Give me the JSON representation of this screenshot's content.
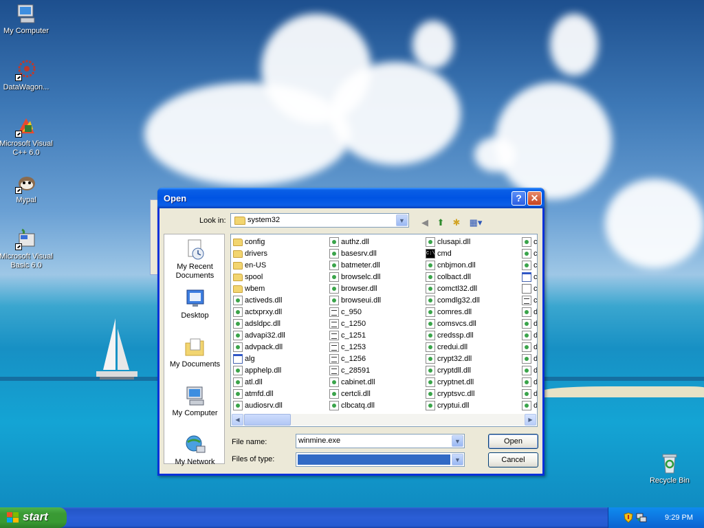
{
  "desktop": {
    "icons": [
      {
        "label": "My Computer"
      },
      {
        "label": "DataWagon..."
      },
      {
        "label": "Microsoft Visual C++ 6.0"
      },
      {
        "label": "Mypal"
      },
      {
        "label": "Microsoft Visual Basic 6.0"
      },
      {
        "label": "Recycle Bin"
      }
    ]
  },
  "dialog": {
    "title": "Open",
    "help_glyph": "?",
    "close_glyph": "✕",
    "look_in_label": "Look in:",
    "look_in_value": "system32",
    "places": [
      {
        "label": "My Recent Documents"
      },
      {
        "label": "Desktop"
      },
      {
        "label": "My Documents"
      },
      {
        "label": "My Computer"
      },
      {
        "label": "My Network"
      }
    ],
    "file_columns": [
      [
        {
          "name": "config",
          "type": "folder"
        },
        {
          "name": "drivers",
          "type": "folder"
        },
        {
          "name": "en-US",
          "type": "folder"
        },
        {
          "name": "spool",
          "type": "folder"
        },
        {
          "name": "wbem",
          "type": "folder"
        },
        {
          "name": "activeds.dll",
          "type": "dll"
        },
        {
          "name": "actxprxy.dll",
          "type": "dll"
        },
        {
          "name": "adsldpc.dll",
          "type": "dll"
        },
        {
          "name": "advapi32.dll",
          "type": "dll"
        },
        {
          "name": "advpack.dll",
          "type": "dll"
        },
        {
          "name": "alg",
          "type": "exe"
        },
        {
          "name": "apphelp.dll",
          "type": "dll"
        },
        {
          "name": "atl.dll",
          "type": "dll"
        },
        {
          "name": "atmfd.dll",
          "type": "dll"
        },
        {
          "name": "audiosrv.dll",
          "type": "dll"
        }
      ],
      [
        {
          "name": "authz.dll",
          "type": "dll"
        },
        {
          "name": "basesrv.dll",
          "type": "dll"
        },
        {
          "name": "batmeter.dll",
          "type": "dll"
        },
        {
          "name": "browselc.dll",
          "type": "dll"
        },
        {
          "name": "browser.dll",
          "type": "dll"
        },
        {
          "name": "browseui.dll",
          "type": "dll"
        },
        {
          "name": "c_950",
          "type": "nls"
        },
        {
          "name": "c_1250",
          "type": "nls"
        },
        {
          "name": "c_1251",
          "type": "nls"
        },
        {
          "name": "c_1253",
          "type": "nls"
        },
        {
          "name": "c_1256",
          "type": "nls"
        },
        {
          "name": "c_28591",
          "type": "nls"
        },
        {
          "name": "cabinet.dll",
          "type": "dll"
        },
        {
          "name": "certcli.dll",
          "type": "dll"
        },
        {
          "name": "clbcatq.dll",
          "type": "dll"
        }
      ],
      [
        {
          "name": "clusapi.dll",
          "type": "dll"
        },
        {
          "name": "cmd",
          "type": "cmd"
        },
        {
          "name": "cnbjmon.dll",
          "type": "dll"
        },
        {
          "name": "colbact.dll",
          "type": "dll"
        },
        {
          "name": "comctl32.dll",
          "type": "dll"
        },
        {
          "name": "comdlg32.dll",
          "type": "dll"
        },
        {
          "name": "comres.dll",
          "type": "dll"
        },
        {
          "name": "comsvcs.dll",
          "type": "dll"
        },
        {
          "name": "credssp.dll",
          "type": "dll"
        },
        {
          "name": "credui.dll",
          "type": "dll"
        },
        {
          "name": "crypt32.dll",
          "type": "dll"
        },
        {
          "name": "cryptdll.dll",
          "type": "dll"
        },
        {
          "name": "cryptnet.dll",
          "type": "dll"
        },
        {
          "name": "cryptsvc.dll",
          "type": "dll"
        },
        {
          "name": "cryptui.dll",
          "type": "dll"
        }
      ],
      [
        {
          "name": "cs",
          "type": "dll"
        },
        {
          "name": "cs",
          "type": "dll"
        },
        {
          "name": "cs",
          "type": "dll"
        },
        {
          "name": "cs",
          "type": "exe"
        },
        {
          "name": "ct",
          "type": "txt"
        },
        {
          "name": "ct",
          "type": "nls"
        },
        {
          "name": "da",
          "type": "dll"
        },
        {
          "name": "dh",
          "type": "dll"
        },
        {
          "name": "dh",
          "type": "dll"
        },
        {
          "name": "di",
          "type": "dll"
        },
        {
          "name": "dr",
          "type": "dll"
        },
        {
          "name": "dr",
          "type": "dll"
        },
        {
          "name": "dr",
          "type": "dll"
        },
        {
          "name": "do",
          "type": "dll"
        },
        {
          "name": "do",
          "type": "dll"
        }
      ]
    ],
    "file_name_label": "File name:",
    "file_name_value": "winmine.exe",
    "files_of_type_label": "Files of type:",
    "files_of_type_value": "",
    "open_label": "Open",
    "cancel_label": "Cancel"
  },
  "taskbar": {
    "start_label": "start",
    "clock": "9:29 PM"
  },
  "colors": {
    "title_blue": "#0054e3",
    "start_green": "#3a9a35",
    "selection_blue": "#316ac5"
  }
}
